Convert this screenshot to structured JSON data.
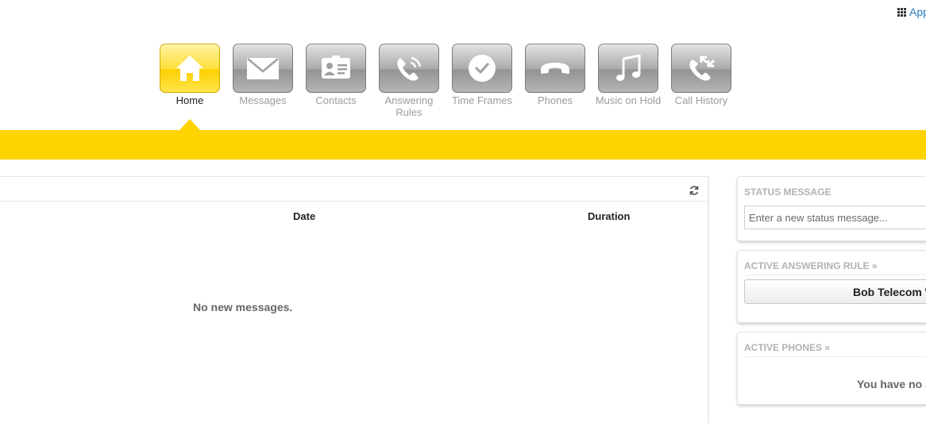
{
  "header": {
    "apps_label": "Apps"
  },
  "nav": {
    "items": [
      {
        "id": "home",
        "label": "Home",
        "active": true,
        "icon": "home-icon"
      },
      {
        "id": "messages",
        "label": "Messages",
        "active": false,
        "icon": "envelope-icon"
      },
      {
        "id": "contacts",
        "label": "Contacts",
        "active": false,
        "icon": "contact-card-icon"
      },
      {
        "id": "answering-rules",
        "label": "Answering Rules",
        "active": false,
        "icon": "phone-ringing-icon"
      },
      {
        "id": "time-frames",
        "label": "Time Frames",
        "active": false,
        "icon": "clock-icon"
      },
      {
        "id": "phones",
        "label": "Phones",
        "active": false,
        "icon": "handset-icon"
      },
      {
        "id": "music-on-hold",
        "label": "Music on Hold",
        "active": false,
        "icon": "music-note-icon"
      },
      {
        "id": "call-history",
        "label": "Call History",
        "active": false,
        "icon": "call-history-icon"
      }
    ]
  },
  "messages_panel": {
    "columns": {
      "date": "Date",
      "duration": "Duration"
    },
    "empty_text": "No new messages."
  },
  "sidebar": {
    "status": {
      "title": "STATUS MESSAGE",
      "placeholder": "Enter a new status message..."
    },
    "rule": {
      "title": "ACTIVE ANSWERING RULE",
      "chevron": "»",
      "button_label": "Bob Telecom W"
    },
    "phones": {
      "title": "ACTIVE PHONES",
      "chevron": "»",
      "empty_text": "You have no a"
    }
  },
  "colors": {
    "accent_yellow": "#fdd300",
    "nav_gray": "#a9a9a9",
    "link_blue": "#2a7ab8"
  }
}
